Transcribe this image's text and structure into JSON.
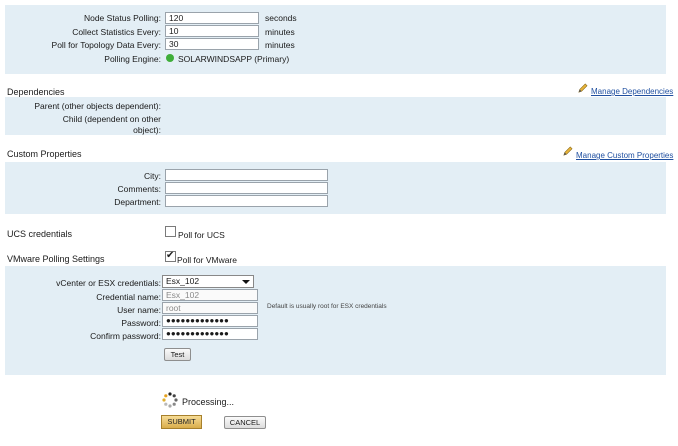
{
  "polling": {
    "node_status_label": "Node Status Polling:",
    "node_status_value": "120",
    "node_status_unit": "seconds",
    "collect_stats_label": "Collect Statistics Every:",
    "collect_stats_value": "10",
    "collect_stats_unit": "minutes",
    "topology_label": "Poll for Topology Data Every:",
    "topology_value": "30",
    "topology_unit": "minutes",
    "engine_label": "Polling Engine:",
    "engine_value": "SOLARWINDSAPP (Primary)",
    "engine_status_color": "#3fae3a"
  },
  "dependencies": {
    "title": "Dependencies",
    "manage_link": "Manage Dependencies",
    "parent_label": "Parent (other objects dependent):",
    "child_label_line1": "Child (dependent on other",
    "child_label_line2": "object):"
  },
  "custom_properties": {
    "title": "Custom Properties",
    "manage_link": "Manage Custom Properties",
    "city_label": "City:",
    "city_value": "",
    "comments_label": "Comments:",
    "comments_value": "",
    "department_label": "Department:",
    "department_value": ""
  },
  "ucs": {
    "title": "UCS credentials",
    "checkbox_label": "Poll for UCS",
    "checked": false
  },
  "vmware": {
    "title": "VMware Polling Settings",
    "checkbox_label": "Poll for VMware",
    "checked": true,
    "credentials_label": "vCenter or ESX credentials:",
    "credentials_selected": "Esx_102",
    "credential_name_label": "Credential name:",
    "credential_name_value": "Esx_102",
    "username_label": "User name:",
    "username_value": "root",
    "username_hint": "Default is usually root for ESX credentials",
    "password_label": "Password:",
    "password_value": "●●●●●●●●●●●●●",
    "confirm_label": "Confirm password:",
    "confirm_value": "●●●●●●●●●●●●●",
    "test_button": "Test"
  },
  "footer": {
    "processing_text": "Processing...",
    "submit_button": "SUBMIT",
    "cancel_button": "CANCEL"
  },
  "colors": {
    "panel_bg": "#e3eef5",
    "link": "#1f4fa0",
    "submit_bg": "#e6c16d"
  }
}
